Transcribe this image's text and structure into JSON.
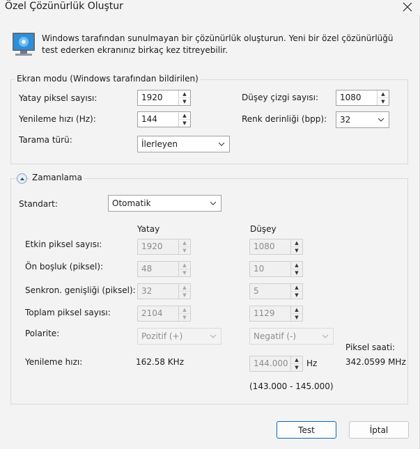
{
  "window": {
    "title": "Özel Çözünürlük Oluştur"
  },
  "intro": {
    "text": "Windows tarafından sunulmayan bir çözünürlük oluşturun. Yeni bir özel çözünürlüğü test ederken ekranınız birkaç kez titreyebilir."
  },
  "display_mode": {
    "legend": "Ekran modu (Windows tarafından bildirilen)",
    "h_pixels_label": "Yatay piksel sayısı:",
    "h_pixels_value": "1920",
    "v_lines_label": "Düşey çizgi sayısı:",
    "v_lines_value": "1080",
    "refresh_label": "Yenileme hızı (Hz):",
    "refresh_value": "144",
    "color_depth_label": "Renk derinliği (bpp):",
    "color_depth_value": "32",
    "scan_type_label": "Tarama türü:",
    "scan_type_value": "İlerleyen"
  },
  "timing": {
    "legend": "Zamanlama",
    "standard_label": "Standart:",
    "standard_value": "Otomatik",
    "col_horizontal": "Yatay",
    "col_vertical": "Düşey",
    "active_pixels_label": "Etkin piksel sayısı:",
    "active_h": "1920",
    "active_v": "1080",
    "front_porch_label": "Ön boşluk (piksel):",
    "front_h": "48",
    "front_v": "10",
    "sync_width_label": "Senkron. genişliği (piksel):",
    "sync_h": "32",
    "sync_v": "5",
    "total_pixels_label": "Toplam piksel sayısı:",
    "total_h": "2104",
    "total_v": "1129",
    "polarity_label": "Polarite:",
    "polarity_h": "Pozitif (+)",
    "polarity_v": "Negatif (-)",
    "refresh_label": "Yenileme hızı:",
    "refresh_h": "162.58 KHz",
    "refresh_v": "144.000",
    "refresh_unit": "Hz",
    "refresh_range": "(143.000 - 145.000)",
    "pixel_clock_label": "Piksel saati:",
    "pixel_clock_value": "342.0599 MHz"
  },
  "buttons": {
    "test": "Test",
    "cancel": "İptal"
  }
}
